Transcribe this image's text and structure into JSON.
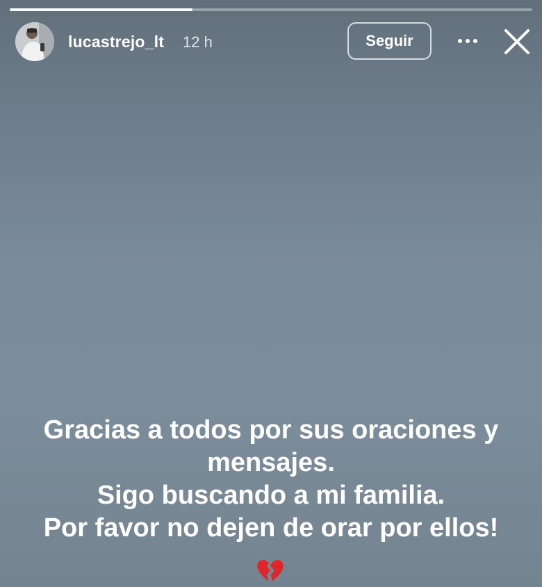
{
  "story": {
    "progress": 0.35
  },
  "header": {
    "username": "lucastrejo_lt",
    "timestamp": "12 h",
    "follow_label": "Seguir",
    "more_icon": "more-options-icon",
    "close_icon": "close-icon",
    "avatar_icon": "profile-avatar"
  },
  "caption": {
    "lines": [
      "Gracias a todos por sus oraciones y",
      "mensajes.",
      "Sigo buscando a mi familia.",
      "Por favor no dejen de orar por ellos!"
    ],
    "emoji": "broken-heart-icon"
  },
  "colors": {
    "background": "#7a8b9a",
    "text": "#ffffff",
    "emoji": "#e0252b"
  }
}
